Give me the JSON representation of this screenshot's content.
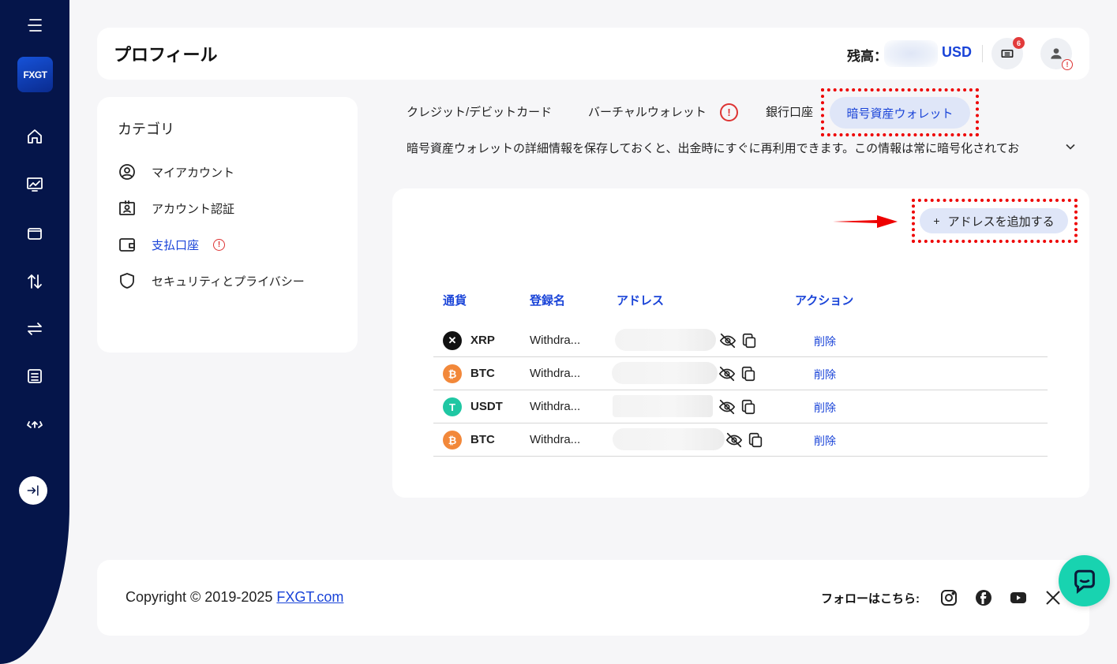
{
  "app": {
    "logo_text": "FXGT"
  },
  "header": {
    "title": "プロフィール",
    "balance_label": "残高：",
    "balance_currency": "USD",
    "notification_count": "6",
    "avatar_alert": "!"
  },
  "categories": {
    "title": "カテゴリ",
    "items": [
      {
        "label": "マイアカウント",
        "icon": "user-circle-icon"
      },
      {
        "label": "アカウント認証",
        "icon": "id-card-icon"
      },
      {
        "label": "支払口座",
        "icon": "wallet-icon",
        "warning": "!"
      },
      {
        "label": "セキュリティとプライバシー",
        "icon": "shield-icon"
      }
    ]
  },
  "tabs": {
    "items": [
      "クレジット/デビットカード",
      "バーチャルウォレット",
      "銀行口座",
      "暗号資産ウォレット"
    ],
    "warning": "!",
    "active_index": 3
  },
  "description": "暗号資産ウォレットの詳細情報を保存しておくと、出金時にすぐに再利用できます。この情報は常に暗号化されてお",
  "wallet": {
    "add_button": {
      "plus": "+",
      "label": "アドレスを追加する"
    },
    "columns": [
      "通貨",
      "登録名",
      "アドレス",
      "アクション"
    ],
    "rows": [
      {
        "coin": "XRP",
        "name": "Withdra...",
        "action": "削除"
      },
      {
        "coin": "BTC",
        "name": "Withdra...",
        "action": "削除"
      },
      {
        "coin": "USDT",
        "name": "Withdra...",
        "action": "削除"
      },
      {
        "coin": "BTC",
        "name": "Withdra...",
        "action": "削除"
      }
    ]
  },
  "footer": {
    "copyright": "Copyright © 2019-2025 ",
    "link": "FXGT.com",
    "follow": "フォローはこちら:"
  },
  "colors": {
    "nav": "#05154a",
    "accent": "#1a44d8",
    "highlight": "#e00000",
    "chat": "#18d3b0"
  }
}
